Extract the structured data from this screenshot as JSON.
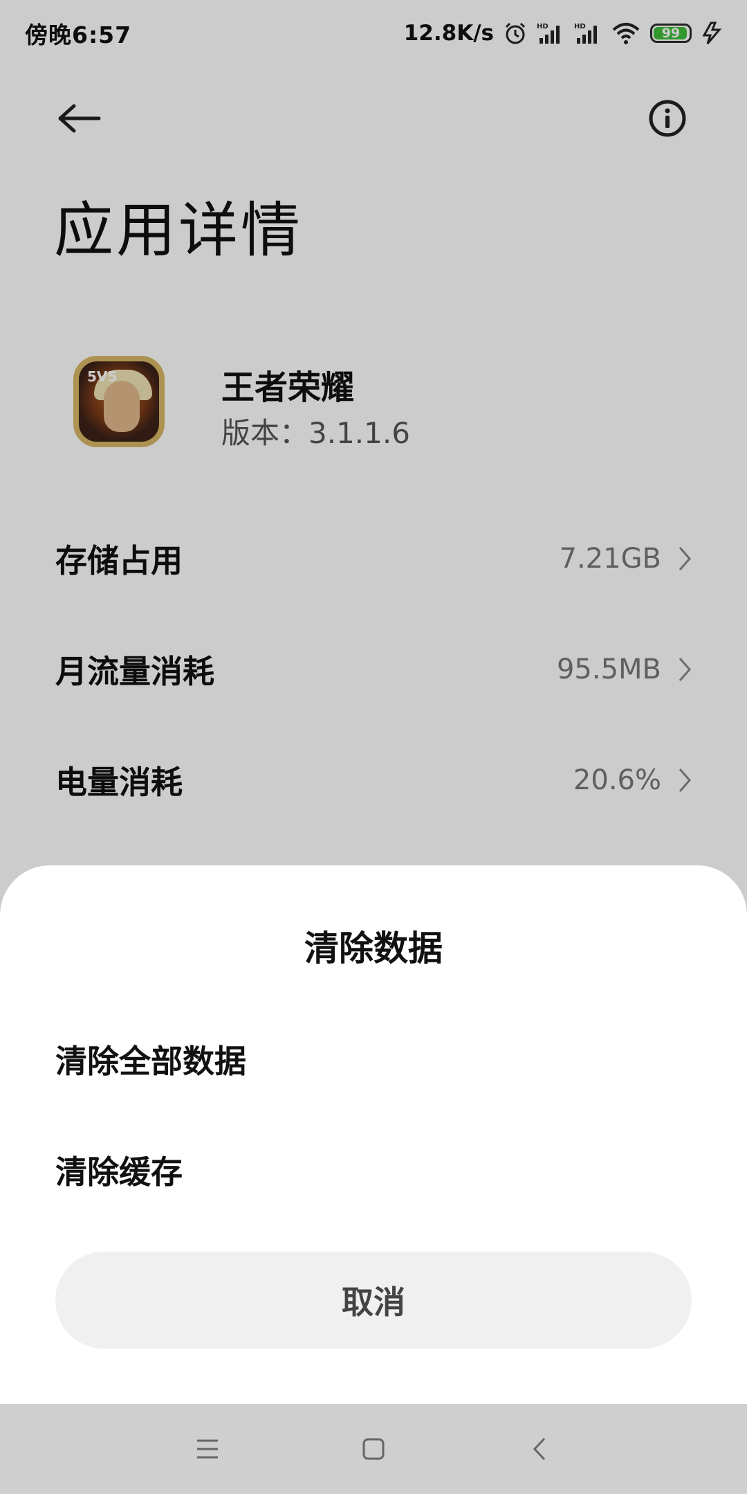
{
  "status_bar": {
    "time": "傍晚6:57",
    "net_speed": "12.8K/s",
    "battery_level": "99",
    "icons": [
      "alarm-icon",
      "hd-signal-icon",
      "hd-signal-icon",
      "wifi-icon",
      "battery-icon",
      "charging-icon"
    ],
    "battery_color": "#3fbf3a"
  },
  "header": {
    "back_icon": "back-arrow-icon",
    "info_icon": "info-icon",
    "title": "应用详情"
  },
  "app": {
    "name": "王者荣耀",
    "version": "版本：3.1.1.6",
    "icon_text": "5V5"
  },
  "details": [
    {
      "label": "存储占用",
      "value": "7.21GB"
    },
    {
      "label": "月流量消耗",
      "value": "95.5MB"
    },
    {
      "label": "电量消耗",
      "value": "20.6%"
    }
  ],
  "sheet": {
    "title": "清除数据",
    "options": [
      "清除全部数据",
      "清除缓存"
    ],
    "cancel_label": "取消"
  },
  "nav_bar": {
    "icons": [
      "menu-icon",
      "home-icon",
      "back-icon"
    ]
  }
}
